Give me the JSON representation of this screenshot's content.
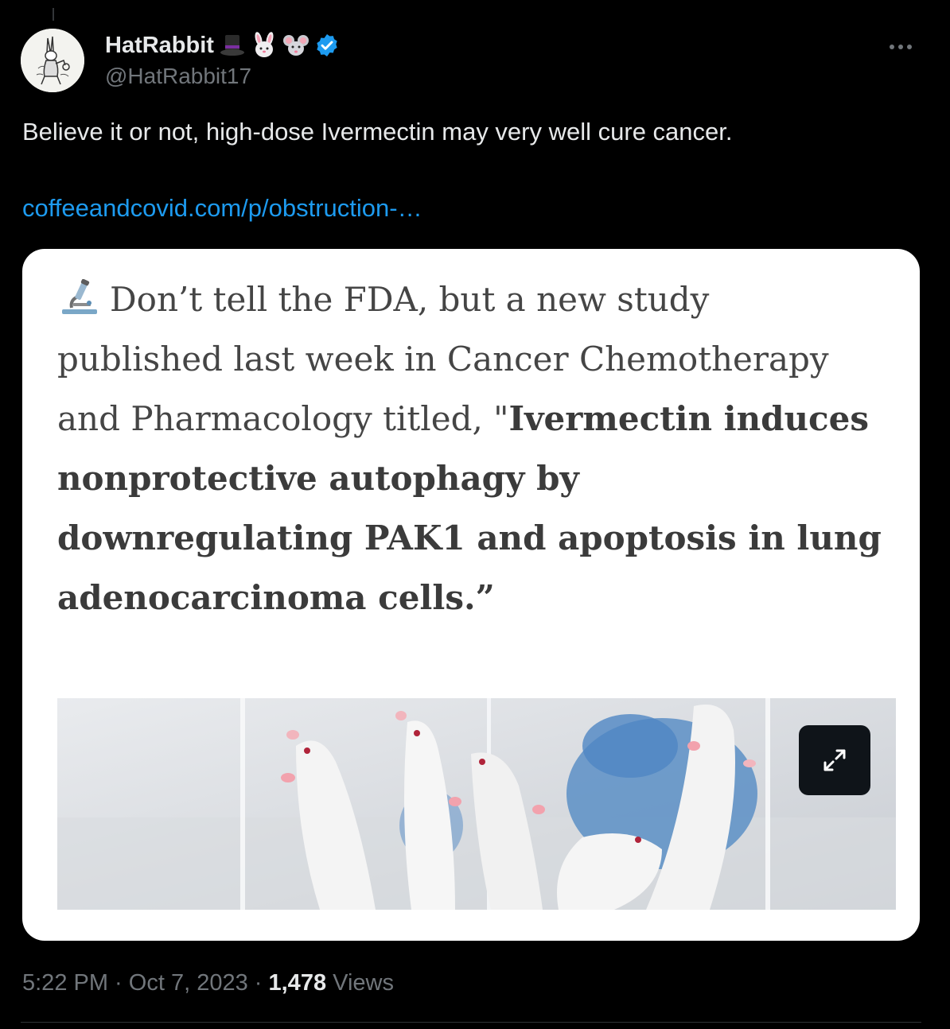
{
  "author": {
    "display_name": "HatRabbit",
    "handle": "@HatRabbit17",
    "name_emojis": [
      "top-hat-emoji",
      "rabbit-emoji",
      "mouse-emoji"
    ],
    "verified_color": "#1d9bf0"
  },
  "tweet": {
    "text": "Believe it or not, high-dose Ivermectin may very well cure cancer.",
    "link": "coffeeandcovid.com/p/obstruction-…"
  },
  "card": {
    "intro": "Don’t tell the FDA, but a new study published last week in Cancer Chemotherapy and Pharmacology titled, \"",
    "bold_title": "Ivermectin induces nonprotective autophagy by downregulating PAK1 and apoptosis in lung adenocarcinoma cells.",
    "closing_quote": "”",
    "icon": "microscope-icon"
  },
  "meta": {
    "time": "5:22 PM",
    "separator_1": " · ",
    "date": "Oct 7, 2023",
    "separator_2": " · ",
    "views_count": "1,478",
    "views_label": " Views"
  },
  "colors": {
    "background": "#000000",
    "text": "#e7e9ea",
    "secondary": "#71767b",
    "link": "#1d9bf0",
    "card_background": "#ffffff"
  }
}
